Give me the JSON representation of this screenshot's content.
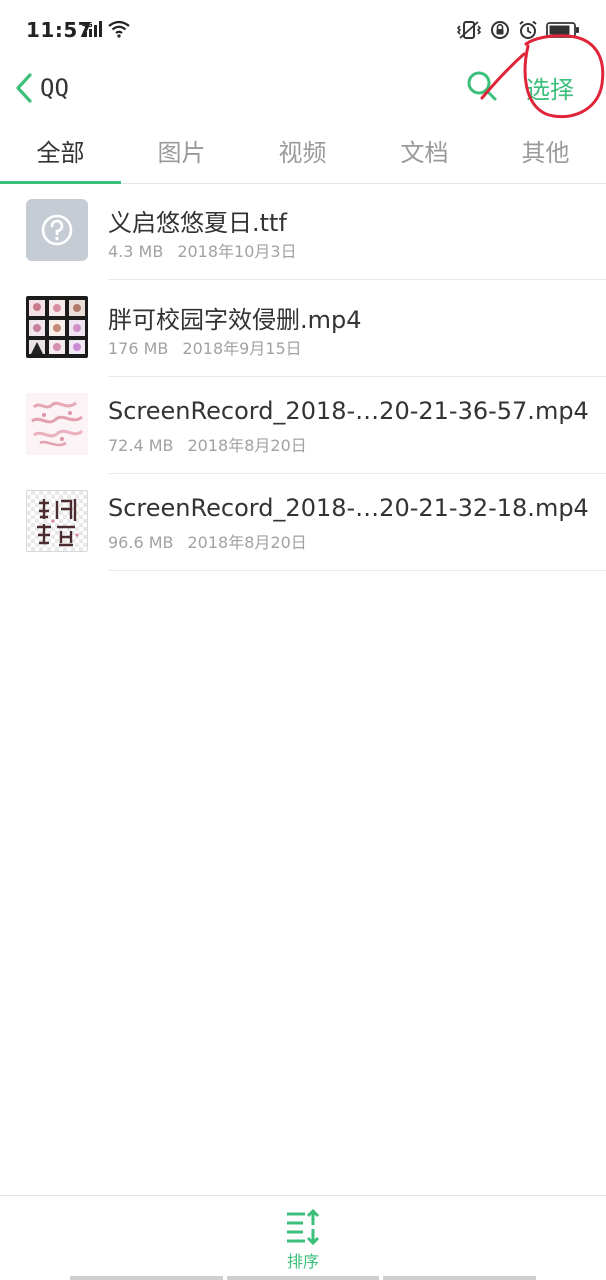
{
  "status_bar": {
    "time": "11:57",
    "network": "4G"
  },
  "header": {
    "back_label": "QQ",
    "select_label": "选择"
  },
  "tabs": [
    {
      "label": "全部",
      "active": true
    },
    {
      "label": "图片",
      "active": false
    },
    {
      "label": "视频",
      "active": false
    },
    {
      "label": "文档",
      "active": false
    },
    {
      "label": "其他",
      "active": false
    }
  ],
  "files": [
    {
      "name": "义启悠悠夏日.ttf",
      "size": "4.3 MB",
      "date": "2018年10月3日",
      "thumb": "unknown-file-icon"
    },
    {
      "name": "胖可校园字效侵删.mp4",
      "size": "176 MB",
      "date": "2018年9月15日",
      "thumb": "video-thumbnail"
    },
    {
      "name": "ScreenRecord_2018-…20-21-36-57.mp4",
      "size": "72.4 MB",
      "date": "2018年8月20日",
      "thumb": "video-thumbnail"
    },
    {
      "name": "ScreenRecord_2018-…20-21-32-18.mp4",
      "size": "96.6 MB",
      "date": "2018年8月20日",
      "thumb": "video-thumbnail"
    }
  ],
  "bottom": {
    "sort_label": "排序"
  },
  "colors": {
    "accent": "#3bbf7b",
    "annotation": "#e0253a"
  }
}
